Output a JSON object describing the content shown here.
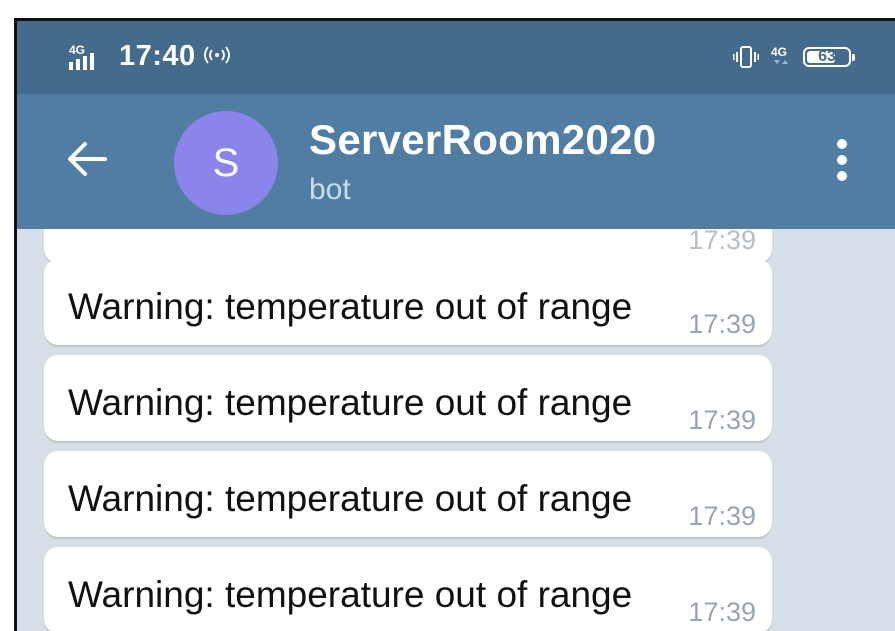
{
  "status_bar": {
    "network_left": "4G",
    "time": "17:40",
    "network_right": "4G",
    "battery": "63"
  },
  "header": {
    "avatar_letter": "S",
    "title": "ServerRoom2020",
    "subtitle": "bot"
  },
  "messages": [
    {
      "text": "Warning: temperature out of range",
      "time": "17:39"
    },
    {
      "text": "Warning: temperature out of range",
      "time": "17:39"
    },
    {
      "text": "Warning: temperature out of range",
      "time": "17:39"
    },
    {
      "text": "Warning: temperature out of range",
      "time": "17:39"
    }
  ],
  "partial_message": {
    "time": "17:39"
  },
  "colors": {
    "status_bar": "#456b8c",
    "header": "#527da3",
    "avatar": "#8b84ea",
    "chat_background": "#d6dfe8"
  }
}
